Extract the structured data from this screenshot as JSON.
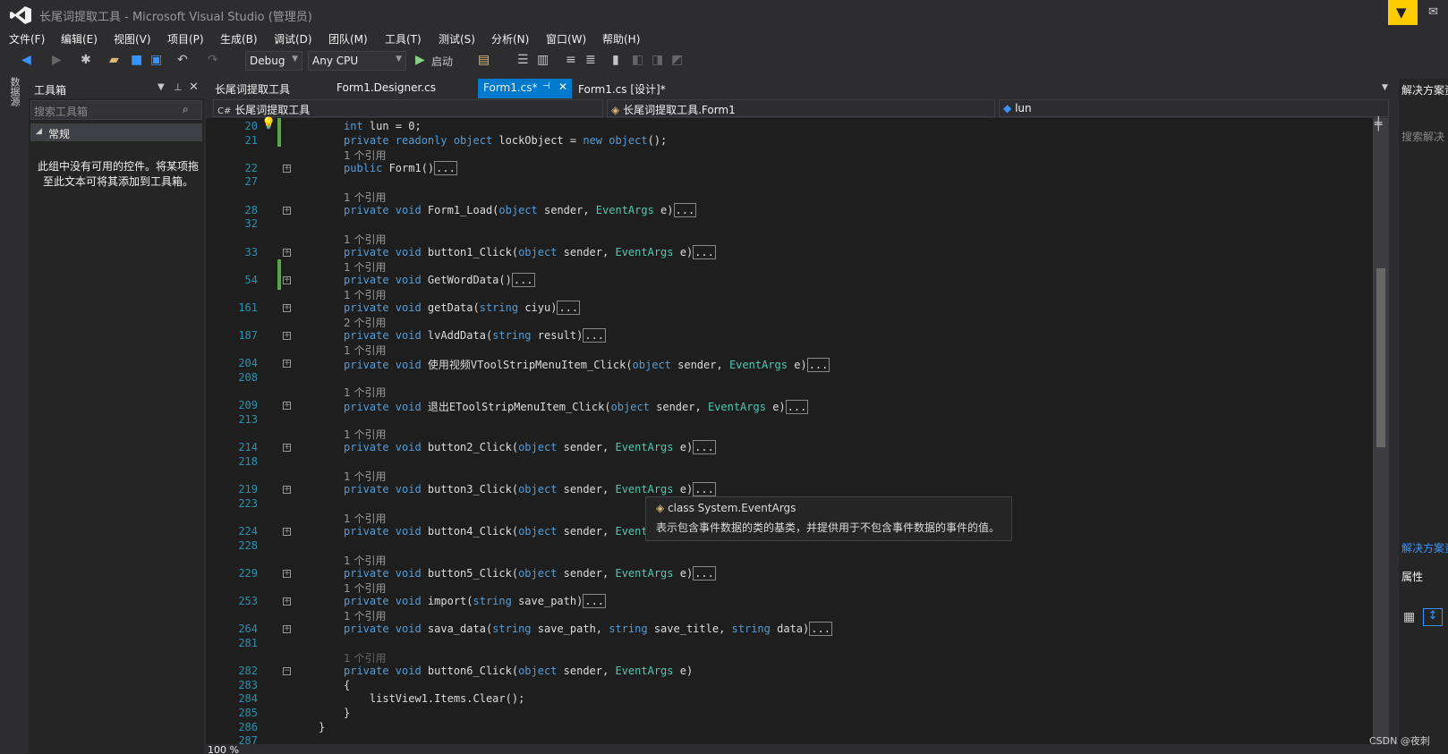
{
  "window": {
    "title": "长尾词提取工具 - Microsoft Visual Studio (管理员)"
  },
  "menu": [
    "文件(F)",
    "编辑(E)",
    "视图(V)",
    "项目(P)",
    "生成(B)",
    "调试(D)",
    "团队(M)",
    "工具(T)",
    "测试(S)",
    "分析(N)",
    "窗口(W)",
    "帮助(H)"
  ],
  "toolbar": {
    "config": "Debug",
    "platform": "Any CPU",
    "start_label": "启动"
  },
  "left_rail": {
    "tab": "数据源"
  },
  "toolbox": {
    "title": "工具箱",
    "search_placeholder": "搜索工具箱",
    "group": "常规",
    "empty_message": "此组中没有可用的控件。将某项拖至此文本可将其添加到工具箱。"
  },
  "tabs": [
    "长尾词提取工具",
    "Form1.Designer.cs",
    "Form1.cs*",
    "Form1.cs [设计]*"
  ],
  "nav": {
    "project": "长尾词提取工具",
    "class": "长尾词提取工具.Form1",
    "member": "lun"
  },
  "code": {
    "ref_1": "1 个引用",
    "ref_2": "2 个引用",
    "lines": [
      {
        "n": "20",
        "text": "int lun = 0;"
      },
      {
        "n": "21",
        "text": "private readonly object lockObject = new object();"
      },
      {
        "n": "22",
        "text": "public Form1()"
      },
      {
        "n": "27",
        "text": ""
      },
      {
        "n": "28",
        "text": "private void Form1_Load(object sender, EventArgs e)"
      },
      {
        "n": "32",
        "text": ""
      },
      {
        "n": "33",
        "text": "private void button1_Click(object sender, EventArgs e)"
      },
      {
        "n": "54",
        "text": "private void GetWordData()"
      },
      {
        "n": "161",
        "text": "private void getData(string ciyu)"
      },
      {
        "n": "187",
        "text": "private void lvAddData(string result)"
      },
      {
        "n": "204",
        "text": "private void 使用视频VToolStripMenuItem_Click(object sender, EventArgs e)"
      },
      {
        "n": "208",
        "text": ""
      },
      {
        "n": "209",
        "text": "private void 退出EToolStripMenuItem_Click(object sender, EventArgs e)"
      },
      {
        "n": "213",
        "text": ""
      },
      {
        "n": "214",
        "text": "private void button2_Click(object sender, EventArgs e)"
      },
      {
        "n": "218",
        "text": ""
      },
      {
        "n": "219",
        "text": "private void button3_Click(object sender, EventArgs e)"
      },
      {
        "n": "223",
        "text": ""
      },
      {
        "n": "224",
        "text": "private void button4_Click(object sender, EventA"
      },
      {
        "n": "228",
        "text": ""
      },
      {
        "n": "229",
        "text": "private void button5_Click(object sender, EventArgs e)"
      },
      {
        "n": "253",
        "text": "private void import(string save_path)"
      },
      {
        "n": "264",
        "text": "private void sava_data(string save_path, string save_title, string data)"
      },
      {
        "n": "281",
        "text": ""
      },
      {
        "n": "282",
        "text": "private void button6_Click(object sender, EventArgs e)"
      },
      {
        "n": "283",
        "text": "{"
      },
      {
        "n": "284",
        "text": "    listView1.Items.Clear();"
      },
      {
        "n": "285",
        "text": "}"
      },
      {
        "n": "286",
        "text": "}"
      },
      {
        "n": "287",
        "text": ""
      }
    ]
  },
  "tooltip": {
    "line1": "class System.EventArgs",
    "line2": "表示包含事件数据的类的基类，并提供用于不包含事件数据的事件的值。"
  },
  "right_panel": {
    "title": "解决方案资源管理器",
    "search": "搜索解决",
    "link": "解决方案资源管理器",
    "properties": "属性"
  },
  "status": {
    "zoom": "100 %"
  },
  "watermark": "CSDN @夜刺",
  "colors": {
    "accent": "#007acc",
    "keyword": "#569cd6",
    "type": "#4ec9b0",
    "line_number": "#2b91af"
  }
}
